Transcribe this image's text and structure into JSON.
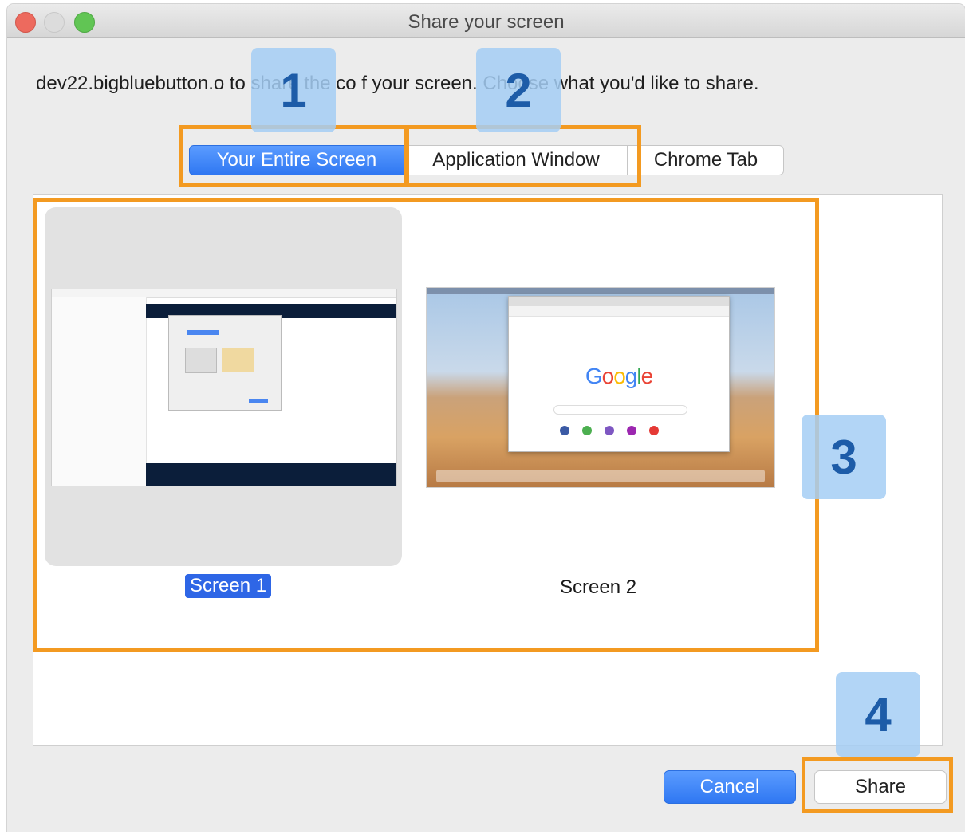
{
  "window": {
    "title": "Share your screen"
  },
  "message": "dev22.bigbluebutton.o                         to share the co                  f your screen. Choose what you'd like to share.",
  "tabs": [
    {
      "label": "Your Entire Screen",
      "selected": true
    },
    {
      "label": "Application Window",
      "selected": false
    },
    {
      "label": "Chrome Tab",
      "selected": false
    }
  ],
  "screens": [
    {
      "label": "Screen 1",
      "selected": true
    },
    {
      "label": "Screen 2",
      "selected": false
    }
  ],
  "preview": {
    "google_logo": "Google"
  },
  "buttons": {
    "cancel": "Cancel",
    "share": "Share"
  },
  "annotations": {
    "markers": [
      "1",
      "2",
      "3",
      "4"
    ],
    "highlight_color": "#f39a21",
    "marker_color": "#a4cef5"
  },
  "colors": {
    "accent": "#2f77f2",
    "close": "#ed6a5e",
    "maximize": "#61c554"
  }
}
